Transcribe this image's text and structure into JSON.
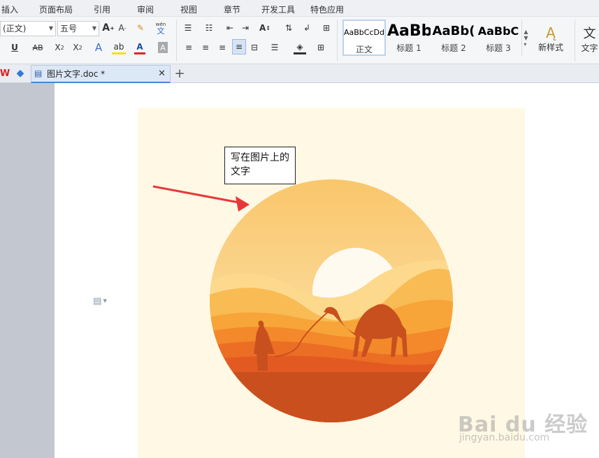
{
  "menu": {
    "items": [
      "插入",
      "页面布局",
      "引用",
      "审阅",
      "视图",
      "章节",
      "开发工具",
      "特色应用"
    ]
  },
  "ribbon": {
    "font_name": "(正文)",
    "font_size": "五号",
    "styles": [
      {
        "sample": "AaBbCcDd",
        "label": "正文"
      },
      {
        "sample": "AaBb",
        "label": "标题 1"
      },
      {
        "sample": "AaBb(",
        "label": "标题 2"
      },
      {
        "sample": "AaBbC",
        "label": "标题 3"
      }
    ],
    "new_style_label": "新样式",
    "text_tools_label": "文字",
    "wen_label": "wén",
    "wen_char": "文"
  },
  "tabs": {
    "doc_name": "图片文字.doc *"
  },
  "document": {
    "textbox_text": "写在图片上的文字"
  },
  "watermark": {
    "main": "Bai du 经验",
    "sub": "jingyan.baidu.com"
  },
  "colors": {
    "accent": "#4a86d0",
    "arrow": "#e8373a",
    "image_bg": "#fff8e4"
  }
}
